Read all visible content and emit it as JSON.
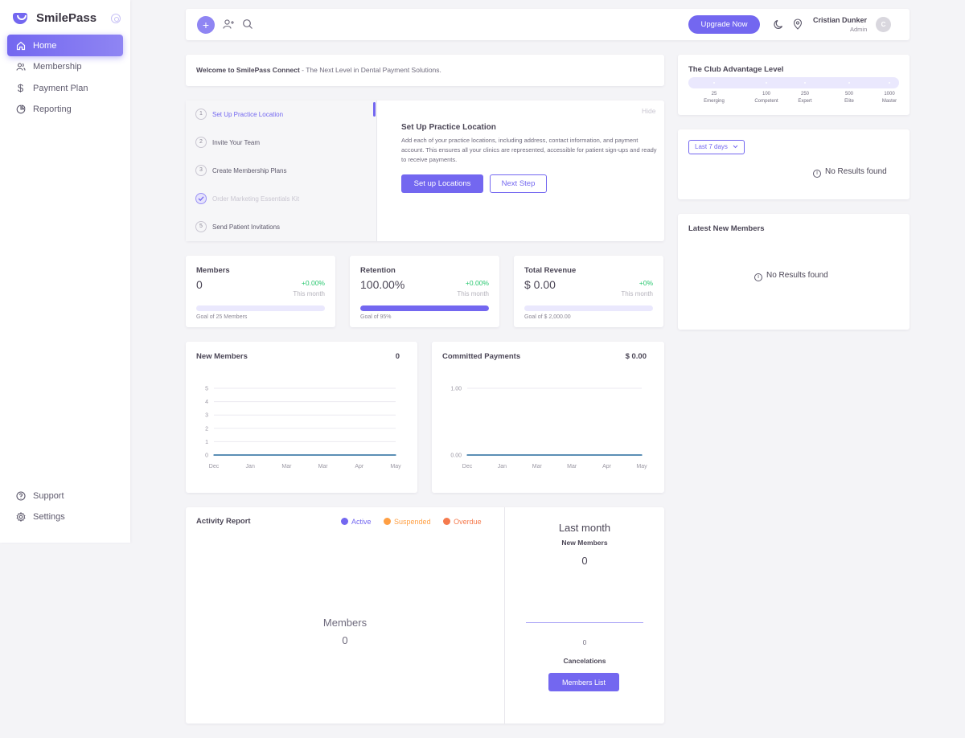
{
  "app": {
    "name": "SmilePass"
  },
  "sidebar": {
    "items": [
      {
        "label": "Home",
        "icon": "home-icon"
      },
      {
        "label": "Membership",
        "icon": "users-icon"
      },
      {
        "label": "Payment Plan",
        "icon": "dollar-icon"
      },
      {
        "label": "Reporting",
        "icon": "pie-chart-icon"
      }
    ],
    "bottom": [
      {
        "label": "Support",
        "icon": "help-circle-icon"
      },
      {
        "label": "Settings",
        "icon": "gear-icon"
      }
    ]
  },
  "topbar": {
    "upgrade_label": "Upgrade Now",
    "user_name": "Cristian Dunker",
    "user_role": "Admin",
    "avatar_initial": "C"
  },
  "welcome": {
    "bold": "Welcome to SmilePass Connect",
    "rest": " - The Next Level in Dental Payment Solutions."
  },
  "setup": {
    "hide_label": "Hide",
    "steps": [
      {
        "num": "1",
        "label": "Set Up Practice Location",
        "state": "active"
      },
      {
        "num": "2",
        "label": "Invite Your Team",
        "state": "pending"
      },
      {
        "num": "3",
        "label": "Create Membership Plans",
        "state": "pending"
      },
      {
        "num": "",
        "label": "Order Marketing Essentials Kit",
        "state": "done"
      },
      {
        "num": "5",
        "label": "Send Patient Invitations",
        "state": "pending"
      }
    ],
    "detail_title": "Set Up Practice Location",
    "detail_text": "Add each of your practice locations, including address, contact information, and payment account. This ensures all your clinics are represented, accessible for patient sign-ups and ready to receive payments.",
    "primary_btn": "Set up Locations",
    "secondary_btn": "Next Step"
  },
  "stats": {
    "members": {
      "label": "Members",
      "value": "0",
      "change": "+0.00%",
      "period": "This month",
      "goal": "Goal of 25 Members",
      "progress": 0
    },
    "retention": {
      "label": "Retention",
      "value": "100.00%",
      "change": "+0.00%",
      "period": "This month",
      "goal": "Goal of 95%",
      "progress": 1
    },
    "revenue": {
      "label": "Total Revenue",
      "value": "$ 0.00",
      "change": "+0%",
      "period": "This month",
      "goal": "Goal of $ 2,000.00",
      "progress": 0
    }
  },
  "club": {
    "title": "The Club Advantage Level",
    "levels": [
      {
        "points": "25",
        "name": "Emerging"
      },
      {
        "points": "100",
        "name": "Competent"
      },
      {
        "points": "250",
        "name": "Expert"
      },
      {
        "points": "500",
        "name": "Elite"
      },
      {
        "points": "1000",
        "name": "Master"
      }
    ]
  },
  "filter": {
    "select_label": "Last 7 days",
    "empty": "No Results found"
  },
  "latest": {
    "title": "Latest New Members",
    "empty": "No Results found"
  },
  "chart_data": [
    {
      "type": "line",
      "title": "New Members",
      "total": "0",
      "categories": [
        "Dec",
        "Jan",
        "Mar",
        "Mar",
        "Apr",
        "May"
      ],
      "y_ticks": [
        "0",
        "1",
        "2",
        "3",
        "4",
        "5"
      ],
      "ylim": [
        0,
        5
      ],
      "series": [
        {
          "values": [
            0,
            0,
            0,
            0,
            0,
            0
          ]
        }
      ]
    },
    {
      "type": "line",
      "title": "Committed Payments",
      "total": "$ 0.00",
      "categories": [
        "Dec",
        "Jan",
        "Mar",
        "Mar",
        "Apr",
        "May"
      ],
      "y_ticks": [
        "0.00",
        "1.00"
      ],
      "ylim": [
        0,
        1
      ],
      "series": [
        {
          "values": [
            0,
            0,
            0,
            0,
            0,
            0
          ]
        }
      ]
    }
  ],
  "activity": {
    "title": "Activity Report",
    "legend": [
      {
        "label": "Active",
        "color": "#7367f0"
      },
      {
        "label": "Suspended",
        "color": "#ff9f43"
      },
      {
        "label": "Overdue",
        "color": "#f57a4d"
      }
    ],
    "center_label": "Members",
    "center_value": "0"
  },
  "last_month": {
    "title": "Last month",
    "new_members_label": "New Members",
    "new_members_value": "0",
    "cancel_value": "0",
    "cancel_label": "Cancelations",
    "button": "Members List"
  },
  "colors": {
    "primary": "#7367f0",
    "success": "#28c76f",
    "warning": "#ff9f43"
  }
}
